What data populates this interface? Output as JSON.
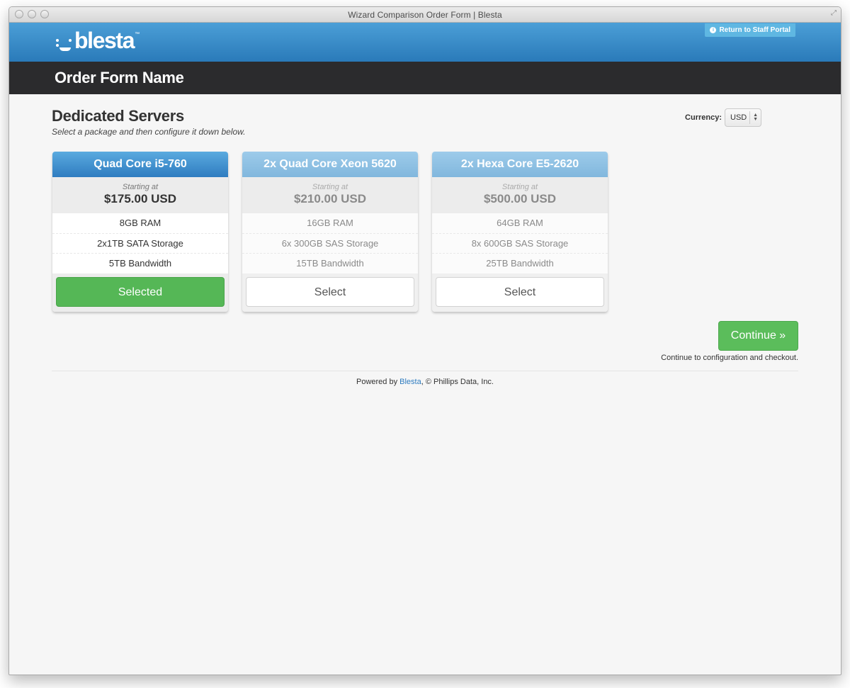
{
  "window": {
    "title": "Wizard Comparison Order Form | Blesta"
  },
  "header": {
    "logo_text": "blesta",
    "logo_tm": "™",
    "staff_portal_label": "Return to Staff Portal"
  },
  "order_form_name": "Order Form Name",
  "page": {
    "title": "Dedicated Servers",
    "subtitle": "Select a package and then configure it down below."
  },
  "currency": {
    "label": "Currency:",
    "value": "USD"
  },
  "packages": [
    {
      "name": "Quad Core i5-760",
      "starting_label": "Starting at",
      "price": "$175.00 USD",
      "features": [
        "8GB RAM",
        "2x1TB SATA Storage",
        "5TB Bandwidth"
      ],
      "button_label": "Selected",
      "selected": true
    },
    {
      "name": "2x Quad Core Xeon 5620",
      "starting_label": "Starting at",
      "price": "$210.00 USD",
      "features": [
        "16GB RAM",
        "6x 300GB SAS Storage",
        "15TB Bandwidth"
      ],
      "button_label": "Select",
      "selected": false
    },
    {
      "name": "2x Hexa Core E5-2620",
      "starting_label": "Starting at",
      "price": "$500.00 USD",
      "features": [
        "64GB RAM",
        "8x 600GB SAS Storage",
        "25TB Bandwidth"
      ],
      "button_label": "Select",
      "selected": false
    }
  ],
  "continue": {
    "label": "Continue »",
    "note": "Continue to configuration and checkout."
  },
  "footer": {
    "prefix": "Powered by",
    "link": "Blesta",
    "suffix": ", © Phillips Data, Inc."
  },
  "colors": {
    "header_blue": "#2a7ab9",
    "name_bar": "#2b2b2d",
    "selected_green": "#55b756",
    "link_blue": "#2f7cc0"
  }
}
